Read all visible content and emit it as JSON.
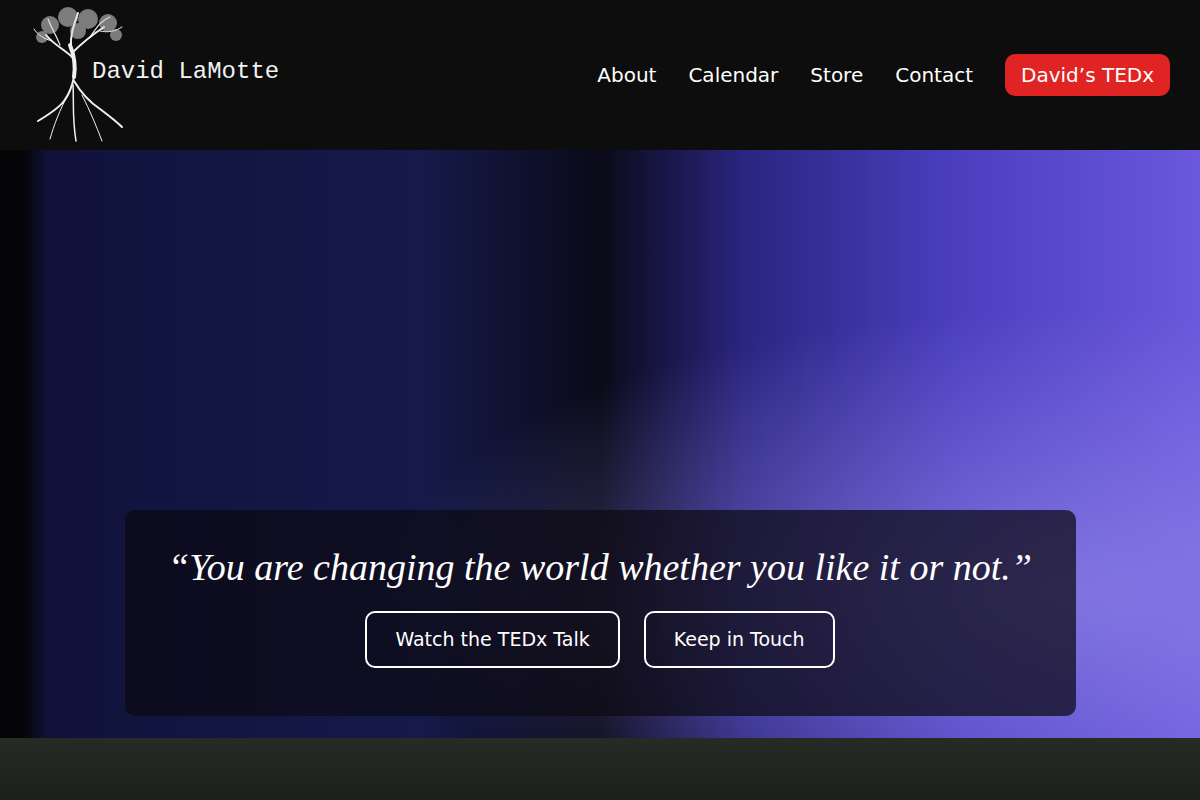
{
  "header": {
    "logo_text": "David LaMotte",
    "nav": [
      {
        "label": "About"
      },
      {
        "label": "Calendar"
      },
      {
        "label": "Store"
      },
      {
        "label": "Contact"
      }
    ],
    "cta": "David’s TEDx"
  },
  "hero": {
    "quote": "“You are changing the world whether you like it or not.”",
    "buttons": [
      "Watch the TEDx Talk",
      "Keep in Touch"
    ]
  }
}
